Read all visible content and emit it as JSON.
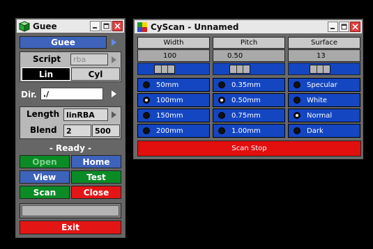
{
  "guee": {
    "title": "Guee",
    "header_button": "Guee",
    "script_label": "Script",
    "script_value": "rba",
    "lin_label": "Lin",
    "cyl_label": "Cyl",
    "dir_label": "Dir.",
    "dir_value": "./",
    "length_label": "Length",
    "length_value": "linRBA",
    "blend_label": "Blend",
    "blend_value_1": "2",
    "blend_value_2": "500",
    "status": "- Ready -",
    "open_label": "Open",
    "home_label": "Home",
    "view_label": "View",
    "test_label": "Test",
    "scan_label": "Scan",
    "close_label": "Close",
    "progress_value": 0,
    "exit_label": "Exit"
  },
  "cyscan": {
    "title": "CyScan - Unnamed",
    "columns": [
      {
        "header": "Width",
        "value": "100",
        "slider_fraction": 0.3,
        "options": [
          "50mm",
          "100mm",
          "150mm",
          "200mm"
        ],
        "selected_index": 1
      },
      {
        "header": "Pitch",
        "value": "0.50",
        "slider_fraction": 0.3,
        "options": [
          "0.35mm",
          "0.50mm",
          "0.75mm",
          "1.00mm"
        ],
        "selected_index": 1
      },
      {
        "header": "Surface",
        "value": "13",
        "slider_fraction": 0.4,
        "options": [
          "Specular",
          "White",
          "Normal",
          "Dark"
        ],
        "selected_index": 2
      }
    ],
    "scan_stop_label": "Scan Stop"
  },
  "colors": {
    "blue": "#3e63ba",
    "green": "#0b8b26",
    "red": "#e31515",
    "radio_blue": "#1446c2"
  }
}
